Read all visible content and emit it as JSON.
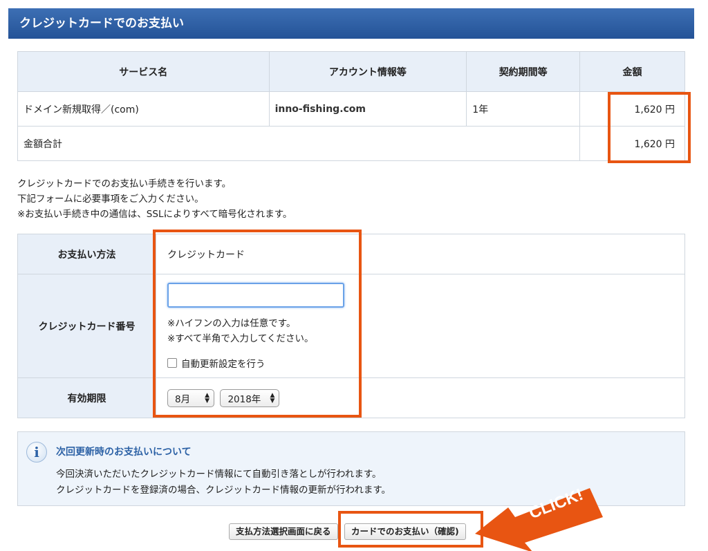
{
  "header": {
    "title": "クレジットカードでのお支払い"
  },
  "summary": {
    "columns": [
      "サービス名",
      "アカウント情報等",
      "契約期間等",
      "金額"
    ],
    "row": {
      "service": "ドメイン新規取得／(com)",
      "account": "inno-fishing.com",
      "period": "1年",
      "amount": "1,620 円"
    },
    "total": {
      "label": "金額合計",
      "amount": "1,620 円"
    }
  },
  "info": {
    "line1": "クレジットカードでのお支払い手続きを行います。",
    "line2": "下記フォームに必要事項をご入力ください。",
    "line3": "※お支払い手続き中の通信は、SSLによりすべて暗号化されます。"
  },
  "form": {
    "method_label": "お支払い方法",
    "method_value": "クレジットカード",
    "card_label": "クレジットカード番号",
    "card_value": "",
    "note1": "※ハイフンの入力は任意です。",
    "note2": "※すべて半角で入力してください。",
    "auto_renew_label": "自動更新設定を行う",
    "expiry_label": "有効期限",
    "month": "8月",
    "year": "2018年"
  },
  "notice": {
    "icon_glyph": "i",
    "title": "次回更新時のお支払いについて",
    "line1": "今回決済いただいたクレジットカード情報にて自動引き落としが行われます。",
    "line2": "クレジットカードを登録済の場合、クレジットカード情報の更新が行われます。"
  },
  "buttons": {
    "back": "支払方法選択画面に戻る",
    "confirm": "カードでのお支払い（確認)"
  },
  "annotation": {
    "click_text": "CLICK!"
  },
  "colors": {
    "highlight": "#e85512",
    "header": "#2f5fa5",
    "accent": "#2d62a6"
  }
}
